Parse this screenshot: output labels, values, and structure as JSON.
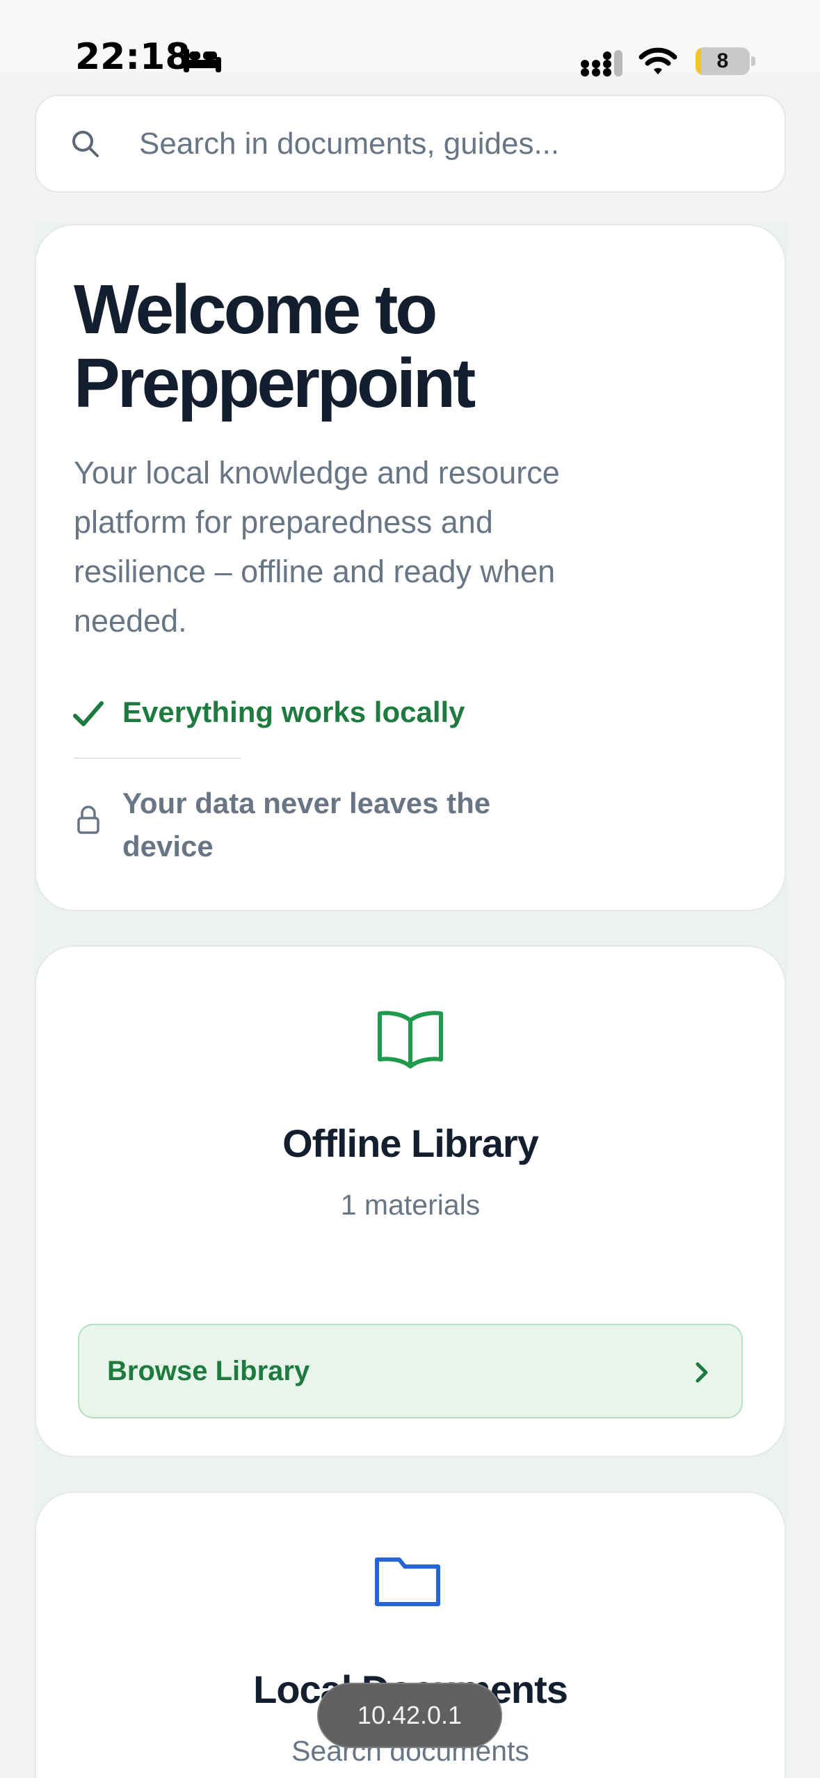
{
  "status_bar": {
    "time": "22:18",
    "battery_level": "8",
    "icons": [
      "sleep-focus-icon",
      "cellular-signal-icon",
      "wifi-icon",
      "battery-icon"
    ],
    "battery_color": "#f2c526"
  },
  "search": {
    "placeholder": "Search in documents, guides...",
    "value": "",
    "icon": "search-icon"
  },
  "welcome": {
    "title": "Welcome to Prepperpoint",
    "description": "Your local knowledge and resource platform for preparedness and resilience – offline and ready when needed.",
    "features": [
      {
        "icon": "checkmark-icon",
        "label": "Everything works locally"
      },
      {
        "icon": "lock-icon",
        "label": "Your data never leaves the device"
      }
    ]
  },
  "library": {
    "icon": "open-book-icon",
    "title": "Offline Library",
    "count": "1 materials",
    "button_label": "Browse Library",
    "button_icon": "chevron-right-icon"
  },
  "documents": {
    "icon": "folder-icon",
    "title": "Local Documents",
    "subtitle": "Search documents"
  },
  "address_pill": "10.42.0.1",
  "colors": {
    "accent_green": "#1e7a3e",
    "accent_green_light": "#e7f5ea",
    "accent_blue": "#2563d8",
    "text_dark": "#131f2f",
    "text_muted": "#687584"
  }
}
